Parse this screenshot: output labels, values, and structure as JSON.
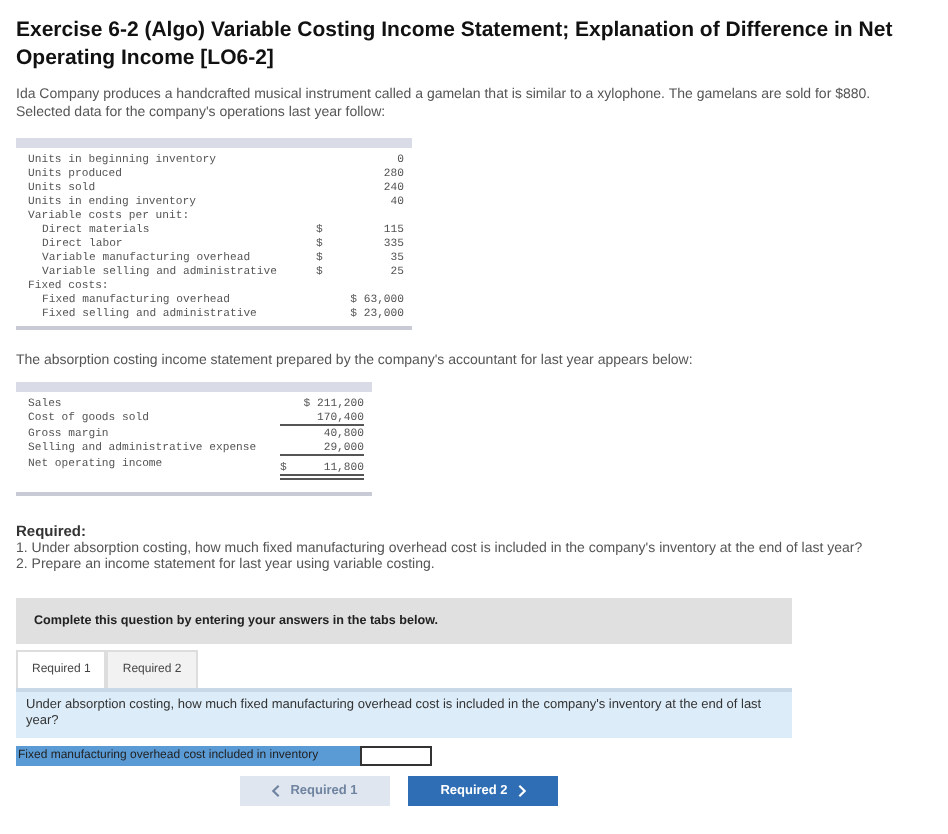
{
  "title": "Exercise 6-2 (Algo) Variable Costing Income Statement; Explanation of Difference in Net Operating Income [LO6-2]",
  "intro": "Ida Company produces a handcrafted musical instrument called a gamelan that is similar to a xylophone. The gamelans are sold for $880. Selected data for the company's operations last year follow:",
  "data_table": [
    {
      "label": "Units in beginning inventory",
      "value": "0"
    },
    {
      "label": "Units produced",
      "value": "280"
    },
    {
      "label": "Units sold",
      "value": "240"
    },
    {
      "label": "Units in ending inventory",
      "value": "40"
    },
    {
      "label": "Variable costs per unit:",
      "children": [
        {
          "label": "Direct materials",
          "dollar": "$",
          "value": "115"
        },
        {
          "label": "Direct labor",
          "dollar": "$",
          "value": "335"
        },
        {
          "label": "Variable manufacturing overhead",
          "dollar": "$",
          "value": "35"
        },
        {
          "label": "Variable selling and administrative",
          "dollar": "$",
          "value": "25"
        }
      ]
    },
    {
      "label": "Fixed costs:",
      "children": [
        {
          "label": "Fixed manufacturing overhead",
          "value": "$ 63,000"
        },
        {
          "label": "Fixed selling and administrative",
          "value": "$ 23,000"
        }
      ]
    }
  ],
  "statement_intro": "The absorption costing income statement prepared by the company's accountant for last year appears below:",
  "statement": [
    {
      "label": "Sales",
      "value": "$ 211,200",
      "kind": "plain"
    },
    {
      "label": "Cost of goods sold",
      "value": "170,400",
      "kind": "subtotal"
    },
    {
      "label": "Gross margin",
      "value": "40,800",
      "kind": "plain"
    },
    {
      "label": "Selling and administrative expense",
      "value": "29,000",
      "kind": "subtotal"
    },
    {
      "label": "Net operating income",
      "dollar": "$",
      "value": "11,800",
      "kind": "total"
    }
  ],
  "required": {
    "heading": "Required:",
    "items": [
      "1. Under absorption costing, how much fixed manufacturing overhead cost is included in the company's inventory at the end of last year?",
      "2. Prepare an income statement for last year using variable costing."
    ]
  },
  "instruction": "Complete this question by entering your answers in the tabs below.",
  "tabs": [
    {
      "label": "Required 1",
      "selected": true
    },
    {
      "label": "Required 2",
      "selected": false
    }
  ],
  "question": "Under absorption costing, how much fixed manufacturing overhead cost is included in the company's inventory at the end of last year?",
  "answer_field": {
    "label": "Fixed manufacturing overhead cost included in inventory"
  },
  "nav_buttons": [
    {
      "label": "Required 1",
      "kind": "prev",
      "disabled": true
    },
    {
      "label": "Required 2",
      "kind": "next",
      "disabled": false
    }
  ]
}
